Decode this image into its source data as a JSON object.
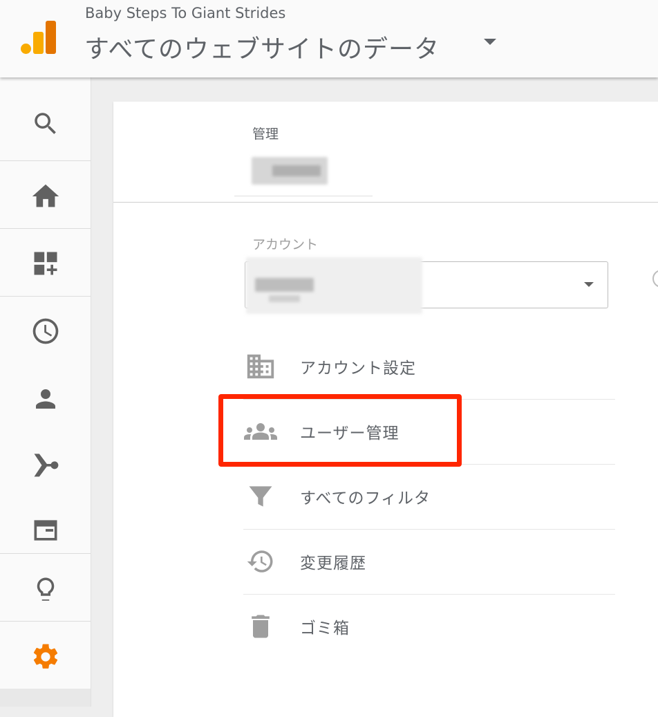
{
  "header": {
    "account_name": "Baby Steps To Giant Strides",
    "property_title": "すべてのウェブサイトのデータ"
  },
  "sidebar": {
    "items": [
      {
        "icon": "search-icon"
      },
      {
        "icon": "home-icon"
      },
      {
        "icon": "customization-icon"
      },
      {
        "icon": "realtime-clock-icon"
      },
      {
        "icon": "audience-person-icon"
      },
      {
        "icon": "acquisition-icon"
      },
      {
        "icon": "behavior-icon"
      },
      {
        "icon": "discover-lightbulb-icon"
      },
      {
        "icon": "admin-gear-icon",
        "active": true,
        "color": "#f57c00"
      }
    ]
  },
  "admin": {
    "section_label": "管理",
    "account_label": "アカウント"
  },
  "menu": [
    {
      "label": "アカウント設定",
      "icon": "building-icon"
    },
    {
      "label": "ユーザー管理",
      "icon": "users-group-icon",
      "highlighted": true
    },
    {
      "label": "すべてのフィルタ",
      "icon": "filter-icon"
    },
    {
      "label": "変更履歴",
      "icon": "history-icon"
    },
    {
      "label": "ゴミ箱",
      "icon": "trash-icon"
    }
  ],
  "colors": {
    "accent": "#f57c00",
    "highlight_border": "#ff2600",
    "icon_gray": "#616161",
    "text_gray": "#5f6368"
  }
}
